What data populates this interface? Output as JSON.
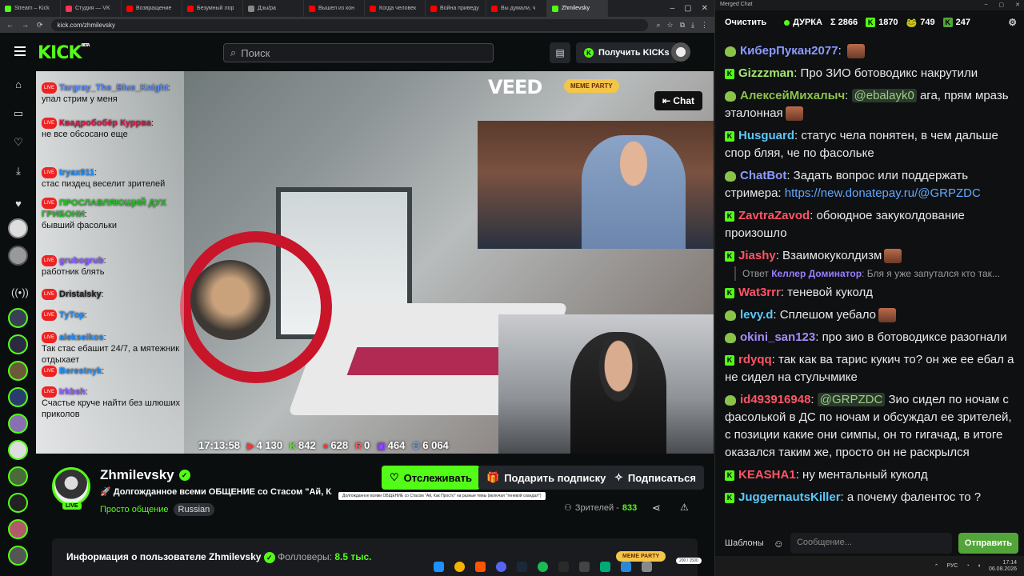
{
  "browser": {
    "tabs": [
      {
        "label": "Stream – Kick",
        "color": "#53fc18"
      },
      {
        "label": "Студия — VK",
        "color": "#ff3355"
      },
      {
        "label": "Возвращение",
        "color": "#ff0000"
      },
      {
        "label": "Безумный лор",
        "color": "#ff0000"
      },
      {
        "label": "Дзы/ра",
        "color": "#888888"
      },
      {
        "label": "Вышел из кон",
        "color": "#ff0000"
      },
      {
        "label": "Когда человек",
        "color": "#ff0000"
      },
      {
        "label": "Война приведу",
        "color": "#ff0000"
      },
      {
        "label": "Вы думали, ч",
        "color": "#ff0000"
      },
      {
        "label": "Zhmilevsky",
        "color": "#53fc18"
      }
    ],
    "url": "kick.com/zhmilevsky"
  },
  "header": {
    "logo": "KICK",
    "logo_beta": "BETA",
    "search_placeholder": "Поиск",
    "kicks_button": "Получить KICKs"
  },
  "overlay_chat": [
    {
      "user": "Targray_The_Blue_Knight",
      "user_color": "#5b8cff",
      "text": "упал стрим у меня"
    },
    {
      "user": "Квадробобёр Куррва",
      "user_color": "#d14",
      "text": "не все обсосано еще"
    },
    {
      "user": "tryax911",
      "user_color": "#1e90ff",
      "text": "стас пиздец веселит зрителей"
    },
    {
      "user": "ПРОСЛАВЛЯЮЩИЙ ДУХ ГРИБОНИ",
      "user_color": "#2bbd2b",
      "text": "бывший фасольки"
    },
    {
      "user": "grubogrub",
      "user_color": "#8a5cff",
      "text": "работник блять"
    },
    {
      "user": "Dristalsky",
      "user_color": "#222222",
      "text": ""
    },
    {
      "user": "ТуТор",
      "user_color": "#1e90ff",
      "text": ""
    },
    {
      "user": "alekseikos",
      "user_color": "#1e90ff",
      "text": "Так стас ебашит 24/7, а мятежник отдыхает"
    },
    {
      "user": "Berestnyk",
      "user_color": "#1e90ff",
      "text": ""
    },
    {
      "user": "Irkbsh",
      "user_color": "#8a5cff",
      "text": "Счастье круче найти без шлюших приколов"
    }
  ],
  "video": {
    "veed": "VEED",
    "meme_party": "MEME PARTY",
    "chat_button": "Chat",
    "time": "17:13:58",
    "stat_youtube": "4 130",
    "stat_kick": "842",
    "stat_vk": "628",
    "stat_rutube": "0",
    "stat_twitch": "464",
    "stat_total": "6 064"
  },
  "channel": {
    "name": "Zhmilevsky",
    "title": "Долгожданное всеми ОБЩЕНИЕ со Стасом \"Ай, К...",
    "tooltip": "Долгожданное всеми ОБЩЕНИЕ со Стасом \"Ай, Как Просто\" на разные темы (включая \"теневой скандал\")",
    "category": "Просто общение",
    "language": "Russian",
    "live": "LIVE",
    "follow_button": "Отслеживать",
    "gift_button": "Подарить подписку",
    "subscribe_button": "Подписаться",
    "viewers_label": "Зрителей -",
    "viewers_count": "833",
    "about_prefix": "Информация о пользователе Zhmilevsky",
    "followers_label": "Фолловеры:",
    "followers_count": "8.5 тыс.",
    "meme_party_bottom": "MEME PARTY",
    "progress_pill": "200 / 1500"
  },
  "chat": {
    "window_title": "Merged Chat",
    "clear_button": "Очистить",
    "channel_label": "ДУРКА",
    "sum_label": "Σ 2866",
    "kick_count": "1870",
    "twitch_count": "749",
    "vk_count": "247",
    "messages": [
      {
        "user": "КиберПукан2077",
        "color": "#8a9bff",
        "badge": "t",
        "text": ""
      },
      {
        "user": "Gizzzman",
        "color": "#a6e66b",
        "badge": "k",
        "text": "Про ЗИО ботоводикс накрутили"
      },
      {
        "user": "АлексейМихалыч",
        "color": "#8bc34a",
        "badge": "t",
        "mention": "@ebalayk0",
        "text": "ага, прям мразь эталонная"
      },
      {
        "user": "Husguard",
        "color": "#5ac8fa",
        "badge": "k",
        "text": "статус чела понятен, в чем дальше спор бляя, че по фасольке"
      },
      {
        "user": "ChatBot",
        "color": "#8a9bff",
        "badge": "t",
        "text": "Задать вопрос или поддержать стримера:",
        "link": "https://new.donatepay.ru/@GRPZDC"
      },
      {
        "user": "ZavtraZavod",
        "color": "#ff5566",
        "badge": "k",
        "text": "обоюдное закуколдование произошло"
      },
      {
        "user": "Jiashy",
        "color": "#ff5566",
        "badge": "k",
        "text": "Взаимокуколдизм"
      },
      {
        "reply_prefix": "Ответ",
        "reply_user": "Келлер Доминатор",
        "reply_text": "Бля я уже запутался кто так..."
      },
      {
        "user": "Wat3rrr",
        "color": "#ff5566",
        "badge": "k",
        "text": "теневой куколд"
      },
      {
        "user": "levy.d",
        "color": "#5ac8fa",
        "badge": "t",
        "text": "Сплешом уебало"
      },
      {
        "user": "okini_san123",
        "color": "#a78bfa",
        "badge": "t",
        "text": "про зио в ботоводиксе разогнали"
      },
      {
        "user": "rdyqq",
        "color": "#ff5566",
        "badge": "k",
        "text": "так как ва тарис кукич то? он же ее ебал а не сидел на стульчмике"
      },
      {
        "user": "id493916948",
        "color": "#ff5566",
        "badge": "t",
        "mention": "@GRPZDC",
        "text": "Зио сидел по ночам с фасолькой в ДС по ночам и обсуждал ее зрителей, с позиции какие они симпы, он то гигачад, в итоге оказался таким же, просто он не раскрылся"
      },
      {
        "user": "KEASHA1",
        "color": "#ff5566",
        "badge": "k",
        "text": "ну ментальный куколд"
      },
      {
        "user": "JuggernautsKiller",
        "color": "#5ac8fa",
        "badge": "k",
        "text": "а почему фалентос то ?"
      }
    ],
    "templates_button": "Шаблоны",
    "input_placeholder": "Сообщение...",
    "send_button": "Отправить"
  },
  "tray": {
    "lang": "РУС",
    "time": "17:14",
    "date": "06.08.2026"
  }
}
